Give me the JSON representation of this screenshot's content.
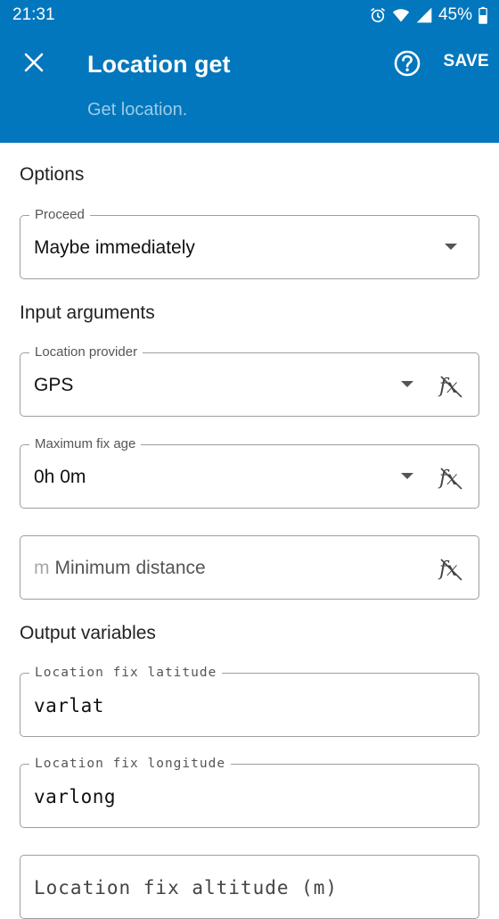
{
  "status_bar": {
    "time": "21:31",
    "battery_percent": "45%",
    "icons": [
      "alarm-icon",
      "wifi-icon",
      "signal-icon",
      "battery-icon"
    ]
  },
  "app_bar": {
    "title": "Location get",
    "subtitle": "Get location.",
    "save_label": "SAVE",
    "icons": [
      "close-icon",
      "help-icon"
    ],
    "background_color": "#0277bd"
  },
  "options": {
    "heading": "Options",
    "proceed": {
      "label": "Proceed",
      "value": "Maybe immediately"
    }
  },
  "input_arguments": {
    "heading": "Input arguments",
    "location_provider": {
      "label": "Location provider",
      "value": "GPS"
    },
    "maximum_fix_age": {
      "label": "Maximum fix age",
      "value": "0h 0m"
    },
    "minimum_distance": {
      "unit": "m",
      "placeholder": "Minimum distance"
    }
  },
  "output_variables": {
    "heading": "Output variables",
    "latitude": {
      "label": "Location fix latitude",
      "value": "varlat"
    },
    "longitude": {
      "label": "Location fix longitude",
      "value": "varlong"
    },
    "altitude": {
      "placeholder": "Location fix altitude (m)"
    }
  }
}
